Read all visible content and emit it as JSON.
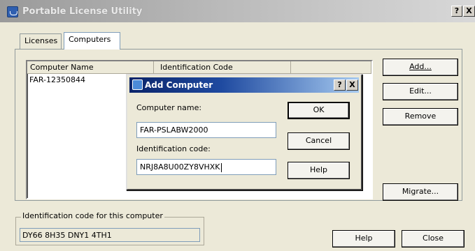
{
  "window": {
    "title": "Portable License Utility",
    "help_button": "?",
    "close_button": "X"
  },
  "tabs": [
    {
      "label": "Licenses",
      "active": false
    },
    {
      "label": "Computers",
      "active": true
    }
  ],
  "list": {
    "columns": [
      "Computer Name",
      "Identification Code",
      ""
    ],
    "rows": [
      {
        "name": "FAR-12350844",
        "code": ""
      }
    ]
  },
  "side_buttons": {
    "add": "Add...",
    "edit": "Edit...",
    "remove": "Remove",
    "migrate": "Migrate..."
  },
  "this_computer": {
    "legend": "Identification code for this computer",
    "value": "DY66 8H35 DNY1 4TH1"
  },
  "bottom_buttons": {
    "help": "Help",
    "close": "Close"
  },
  "dialog": {
    "title": "Add Computer",
    "help_button": "?",
    "close_button": "X",
    "computer_name_label": "Computer name:",
    "computer_name_value": "FAR-PSLABW2000",
    "id_code_label": "Identification code:",
    "id_code_value": "NRJ8A8U00ZY8VHXK",
    "ok": "OK",
    "cancel": "Cancel",
    "help": "Help"
  },
  "colors": {
    "dialog_title_start": "#0a246a",
    "dialog_title_end": "#a6caf0",
    "window_face": "#ece9d8",
    "inactive_title": "#b9b9b9"
  }
}
